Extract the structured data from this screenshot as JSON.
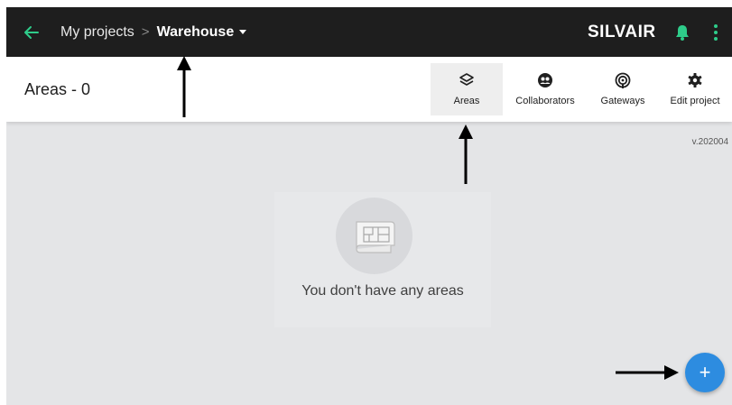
{
  "header": {
    "breadcrumb_parent": "My projects",
    "breadcrumb_separator": ">",
    "project_name": "Warehouse",
    "brand": "SILVAIR"
  },
  "toolbar": {
    "title": "Areas - 0",
    "tabs": [
      {
        "label": "Areas",
        "icon": "layers-icon",
        "active": true
      },
      {
        "label": "Collaborators",
        "icon": "collaborators-icon",
        "active": false
      },
      {
        "label": "Gateways",
        "icon": "gateway-icon",
        "active": false
      },
      {
        "label": "Edit project",
        "icon": "gear-icon",
        "active": false
      }
    ]
  },
  "main": {
    "version": "v.202004",
    "empty_message": "You don't have any areas",
    "fab_symbol": "+"
  },
  "colors": {
    "topbar_bg": "#1e1e1e",
    "accent_green": "#2ecc8a",
    "fab_blue": "#2d8ce0",
    "canvas_bg": "#e4e5e7"
  }
}
